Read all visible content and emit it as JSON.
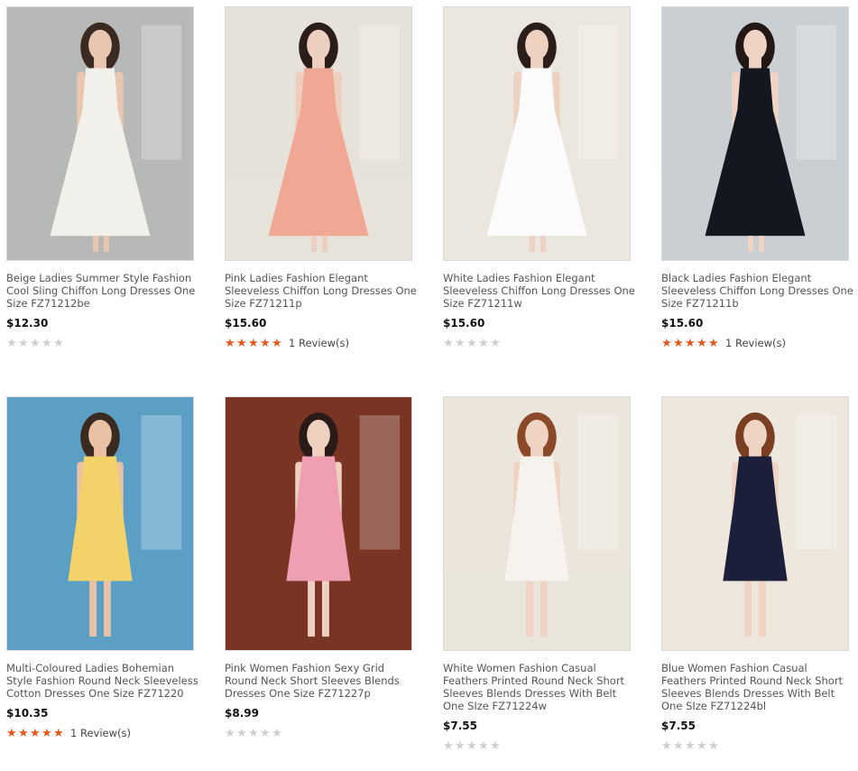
{
  "products": [
    {
      "title": "Beige Ladies Summer Style Fashion Cool Sling Chiffon Long Dresses One Size FZ71212be",
      "price": "$12.30",
      "rating_stars": 0,
      "reviews": "",
      "bg": "#b7b9b8",
      "dress": "#f2f0ea",
      "skin": "#e9c6b0",
      "hair": "#3a2a22"
    },
    {
      "title": "Pink Ladies Fashion Elegant Sleeveless Chiffon Long Dresses One Size FZ71211p",
      "price": "$15.60",
      "rating_stars": 5,
      "reviews": "1 Review(s)",
      "bg": "#e7e2d9",
      "dress": "#f0a793",
      "skin": "#edcfbf",
      "hair": "#2b1e1a"
    },
    {
      "title": "White Ladies Fashion Elegant Sleeveless Chiffon Long Dresses One Size FZ71211w",
      "price": "$15.60",
      "rating_stars": 0,
      "reviews": "",
      "bg": "#ebe6de",
      "dress": "#fbfbfb",
      "skin": "#edd2c2",
      "hair": "#2b1e1a"
    },
    {
      "title": "Black Ladies Fashion Elegant Sleeveless Chiffon Long Dresses One Size FZ71211b",
      "price": "$15.60",
      "rating_stars": 5,
      "reviews": "1 Review(s)",
      "bg": "#c9cfd2",
      "dress": "#141720",
      "skin": "#efd3c4",
      "hair": "#231815"
    },
    {
      "title": "Multi-Coloured Ladies Bohemian Style Fashion Round Neck Sleeveless Cotton Dresses One Size FZ71220",
      "price": "$10.35",
      "rating_stars": 5,
      "reviews": "1 Review(s)",
      "bg": "#5b9fc4",
      "dress": "#f3d26a",
      "skin": "#e9c1a4",
      "hair": "#3b2a20"
    },
    {
      "title": "Pink Women Fashion Sexy Grid Round Neck Short Sleeves Blends Dresses One Size FZ71227p",
      "price": "$8.99",
      "rating_stars": 0,
      "reviews": "",
      "bg": "#7a3424",
      "dress": "#ef9fb1",
      "skin": "#edd0bd",
      "hair": "#2a1b18"
    },
    {
      "title": "White Women Fashion Casual Feathers Printed Round Neck Short Sleeves Blends Dresses With Belt One SIze FZ71224w",
      "price": "$7.55",
      "rating_stars": 0,
      "reviews": "",
      "bg": "#ebe5dc",
      "dress": "#f6f2ee",
      "skin": "#f0d4c3",
      "hair": "#8a4a2a"
    },
    {
      "title": "Blue Women Fashion Casual Feathers Printed Round Neck Short Sleeves Blends Dresses With Belt One SIze FZ71224bl",
      "price": "$7.55",
      "rating_stars": 0,
      "reviews": "",
      "bg": "#ede7de",
      "dress": "#1c1f3a",
      "skin": "#f0d4c3",
      "hair": "#7a3f22"
    }
  ],
  "colors": {
    "star_on": "#e8581e",
    "star_off": "#cfcfcf",
    "title_text": "#555555",
    "price_text": "#111111"
  }
}
